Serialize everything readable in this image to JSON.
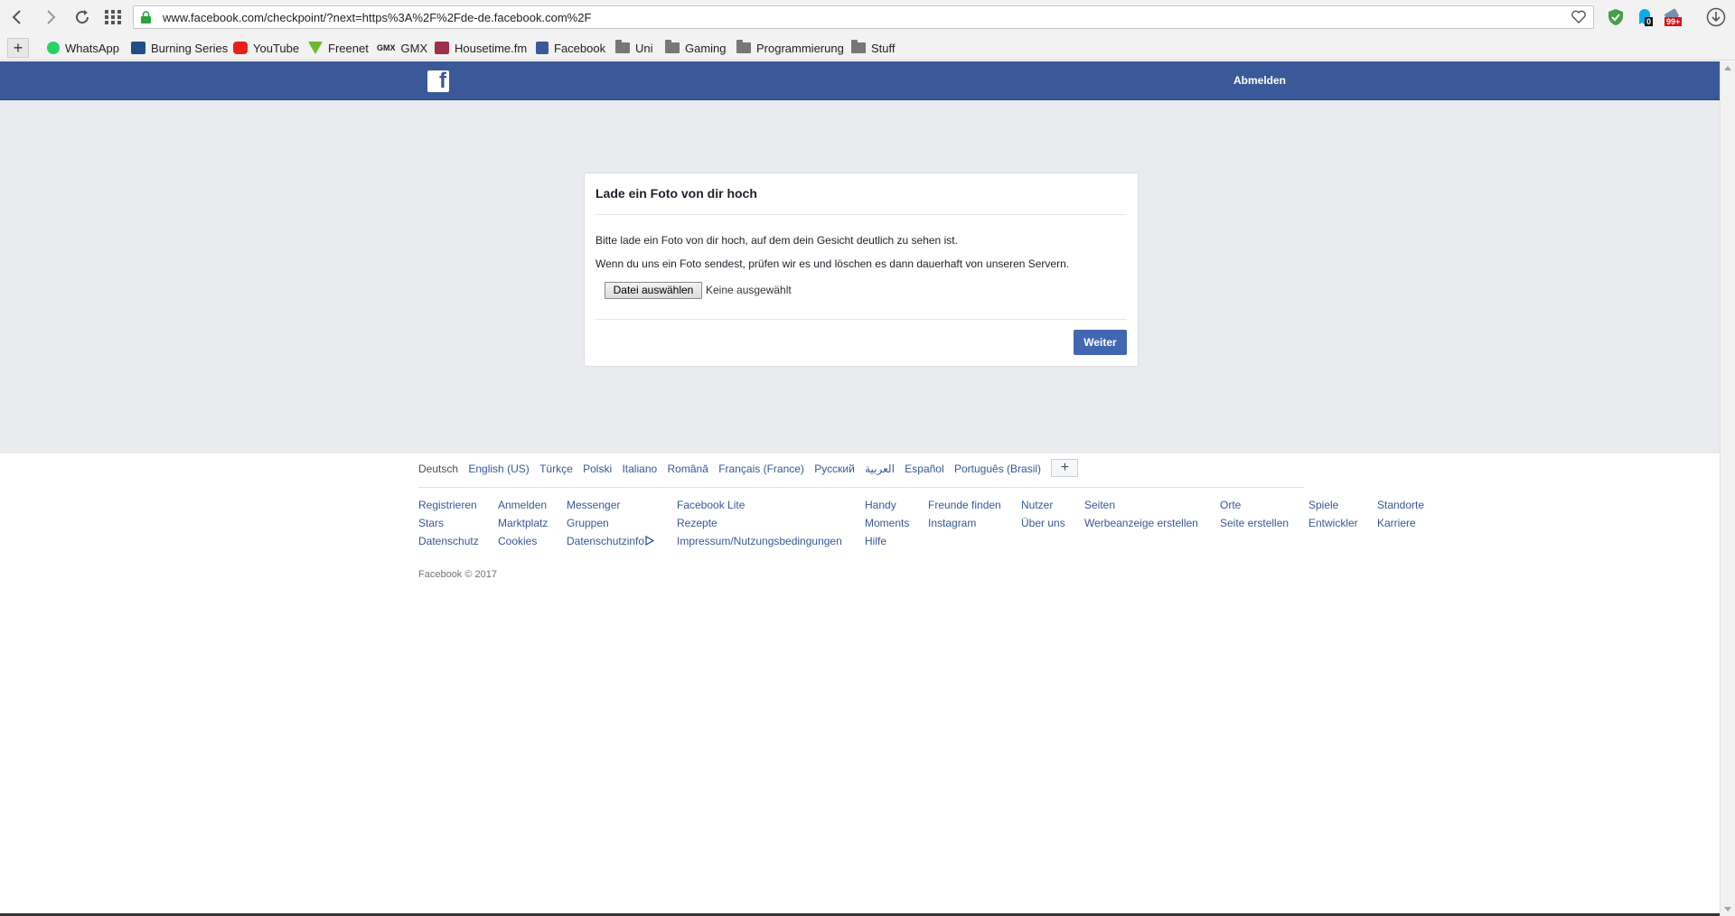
{
  "browser": {
    "url": "www.facebook.com/checkpoint/?next=https%3A%2F%2Fde-de.facebook.com%2F",
    "badges": {
      "ext1": "0",
      "ext2": "99+"
    },
    "bookmarks": [
      {
        "label": "WhatsApp",
        "icon": "whatsapp-icon",
        "color": "#25d366"
      },
      {
        "label": "Burning Series",
        "icon": "bs-icon",
        "color": "#1e4f8a"
      },
      {
        "label": "YouTube",
        "icon": "youtube-icon",
        "color": "#e62117"
      },
      {
        "label": "Freenet",
        "icon": "freenet-icon",
        "color": "#6bb92d"
      },
      {
        "label": "GMX",
        "icon": "gmx-icon",
        "color": "#1c449b"
      },
      {
        "label": "Housetime.fm",
        "icon": "housetime-icon",
        "color": "#a0304a"
      },
      {
        "label": "Facebook",
        "icon": "facebook-icon",
        "color": "#3b5998"
      },
      {
        "label": "Uni",
        "icon": "folder-icon",
        "color": "#777777"
      },
      {
        "label": "Gaming",
        "icon": "folder-icon",
        "color": "#777777"
      },
      {
        "label": "Programmierung",
        "icon": "folder-icon",
        "color": "#777777"
      },
      {
        "label": "Stuff",
        "icon": "folder-icon",
        "color": "#777777"
      }
    ]
  },
  "header": {
    "logo": "f",
    "logout_label": "Abmelden",
    "brand_color": "#3b5998"
  },
  "dialog": {
    "title": "Lade ein Foto von dir hoch",
    "text1": "Bitte lade ein Foto von dir hoch, auf dem dein Gesicht deutlich zu sehen ist.",
    "text2": "Wenn du uns ein Foto sendest, prüfen wir es und löschen es dann dauerhaft von unseren Servern.",
    "file_button": "Datei auswählen",
    "file_status": "Keine ausgewählt",
    "next_button": "Weiter"
  },
  "footer": {
    "languages": [
      "Deutsch",
      "English (US)",
      "Türkçe",
      "Polski",
      "Italiano",
      "Română",
      "Français (France)",
      "Русский",
      "العربية",
      "Español",
      "Português (Brasil)"
    ],
    "more_languages": "+",
    "columns": [
      [
        "Registrieren",
        "Stars",
        "Datenschutz"
      ],
      [
        "Anmelden",
        "Marktplatz",
        "Cookies"
      ],
      [
        "Messenger",
        "Gruppen",
        "Datenschutzinfo"
      ],
      [
        "Facebook Lite",
        "Rezepte",
        "Impressum/Nutzungsbedingungen"
      ],
      [
        "Handy",
        "Moments",
        "Hilfe"
      ],
      [
        "Freunde finden",
        "Instagram"
      ],
      [
        "Nutzer",
        "Über uns"
      ],
      [
        "Seiten",
        "Werbeanzeige erstellen"
      ],
      [
        "Orte",
        "Seite erstellen"
      ],
      [
        "Spiele",
        "Entwickler"
      ],
      [
        "Standorte",
        "Karriere"
      ]
    ],
    "copyright": "Facebook © 2017"
  }
}
